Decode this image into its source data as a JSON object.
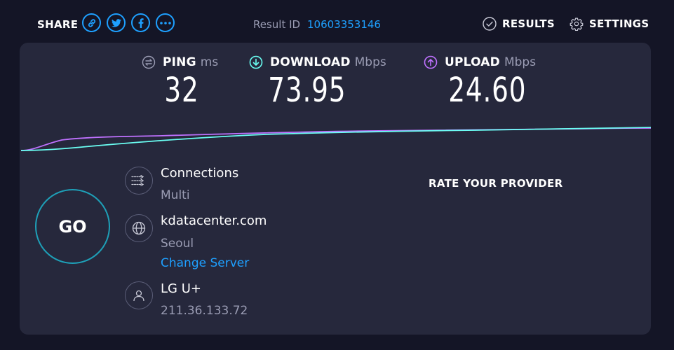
{
  "header": {
    "share_label": "SHARE",
    "share_buttons": [
      {
        "icon": "link-icon"
      },
      {
        "icon": "twitter-icon"
      },
      {
        "icon": "facebook-icon"
      },
      {
        "icon": "more-icon"
      }
    ],
    "result_id_label": "Result ID",
    "result_id_value": "10603353146",
    "results_label": "RESULTS",
    "settings_label": "SETTINGS"
  },
  "metrics": {
    "ping": {
      "name": "PING",
      "unit": "ms",
      "value": "32",
      "color": "#9a9cb3"
    },
    "download": {
      "name": "DOWNLOAD",
      "unit": "Mbps",
      "value": "73.95",
      "color": "#6afff3"
    },
    "upload": {
      "name": "UPLOAD",
      "unit": "Mbps",
      "value": "24.60",
      "color": "#bf71ff"
    }
  },
  "go_label": "GO",
  "connections": {
    "title": "Connections",
    "value": "Multi"
  },
  "server": {
    "host": "kdatacenter.com",
    "location": "Seoul",
    "change_label": "Change Server"
  },
  "provider": {
    "name": "LG U+",
    "ip": "211.36.133.72"
  },
  "rate_provider_label": "RATE YOUR PROVIDER",
  "colors": {
    "accent": "#1ea0ff",
    "background": "#141526",
    "panel": "#26283c"
  }
}
